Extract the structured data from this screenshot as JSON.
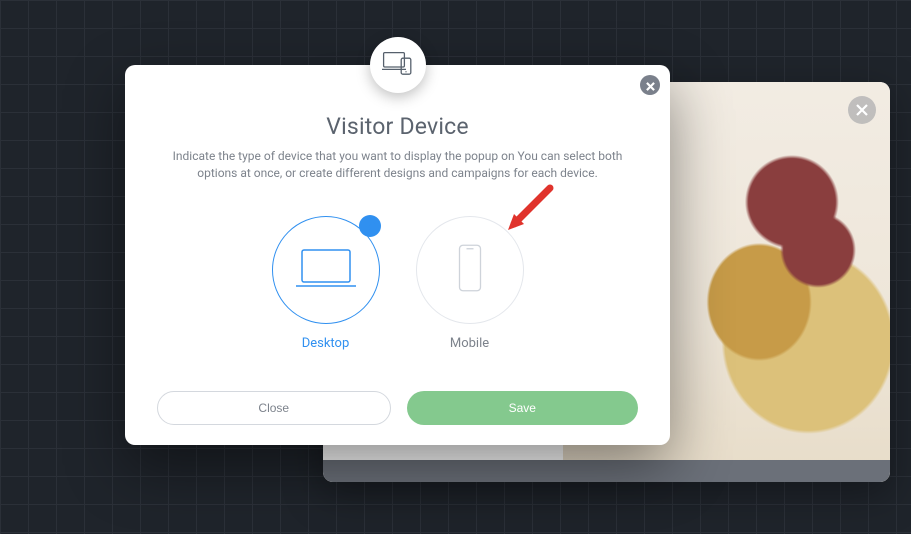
{
  "preview": {
    "close_label": "close"
  },
  "modal": {
    "close_label": "close",
    "header_icon": "devices-icon",
    "title": "Visitor Device",
    "description": "Indicate the type of device that you want to display the popup on You can select both options at once, or create different designs and campaigns for each device.",
    "options": {
      "desktop": {
        "label": "Desktop",
        "selected": true
      },
      "mobile": {
        "label": "Mobile",
        "selected": false
      }
    },
    "buttons": {
      "close": "Close",
      "save": "Save"
    }
  },
  "annotation": {
    "arrow_target": "mobile-option"
  }
}
